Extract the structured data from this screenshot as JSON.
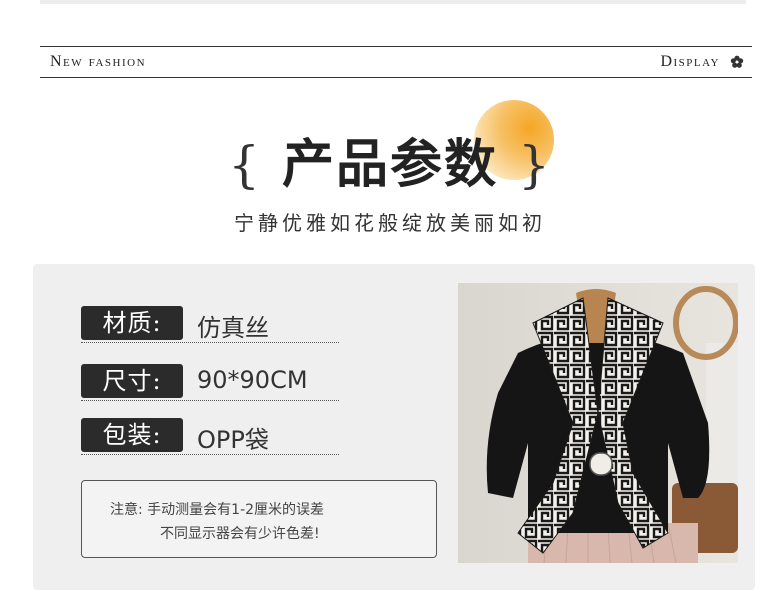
{
  "header": {
    "left_text": "New fashion",
    "right_text": "Display"
  },
  "title": {
    "open_brace": "{",
    "text": "产品参数",
    "close_brace": "}"
  },
  "subtitle": "宁静优雅如花般绽放美丽如初",
  "params": [
    {
      "label": "材质:",
      "value": "仿真丝"
    },
    {
      "label": "尺寸:",
      "value": "90*90CM"
    },
    {
      "label": "包装:",
      "value": "OPP袋"
    }
  ],
  "note": {
    "line1": "注意:  手动测量会有1-2厘米的误差",
    "line2": "不同显示器会有少许色差!"
  },
  "colors": {
    "accent": "#f5a623",
    "dark": "#2b2b2b",
    "panel": "#efefef"
  },
  "icons": {
    "header_right": "flower-icon",
    "title_decor": "sun-circle"
  }
}
